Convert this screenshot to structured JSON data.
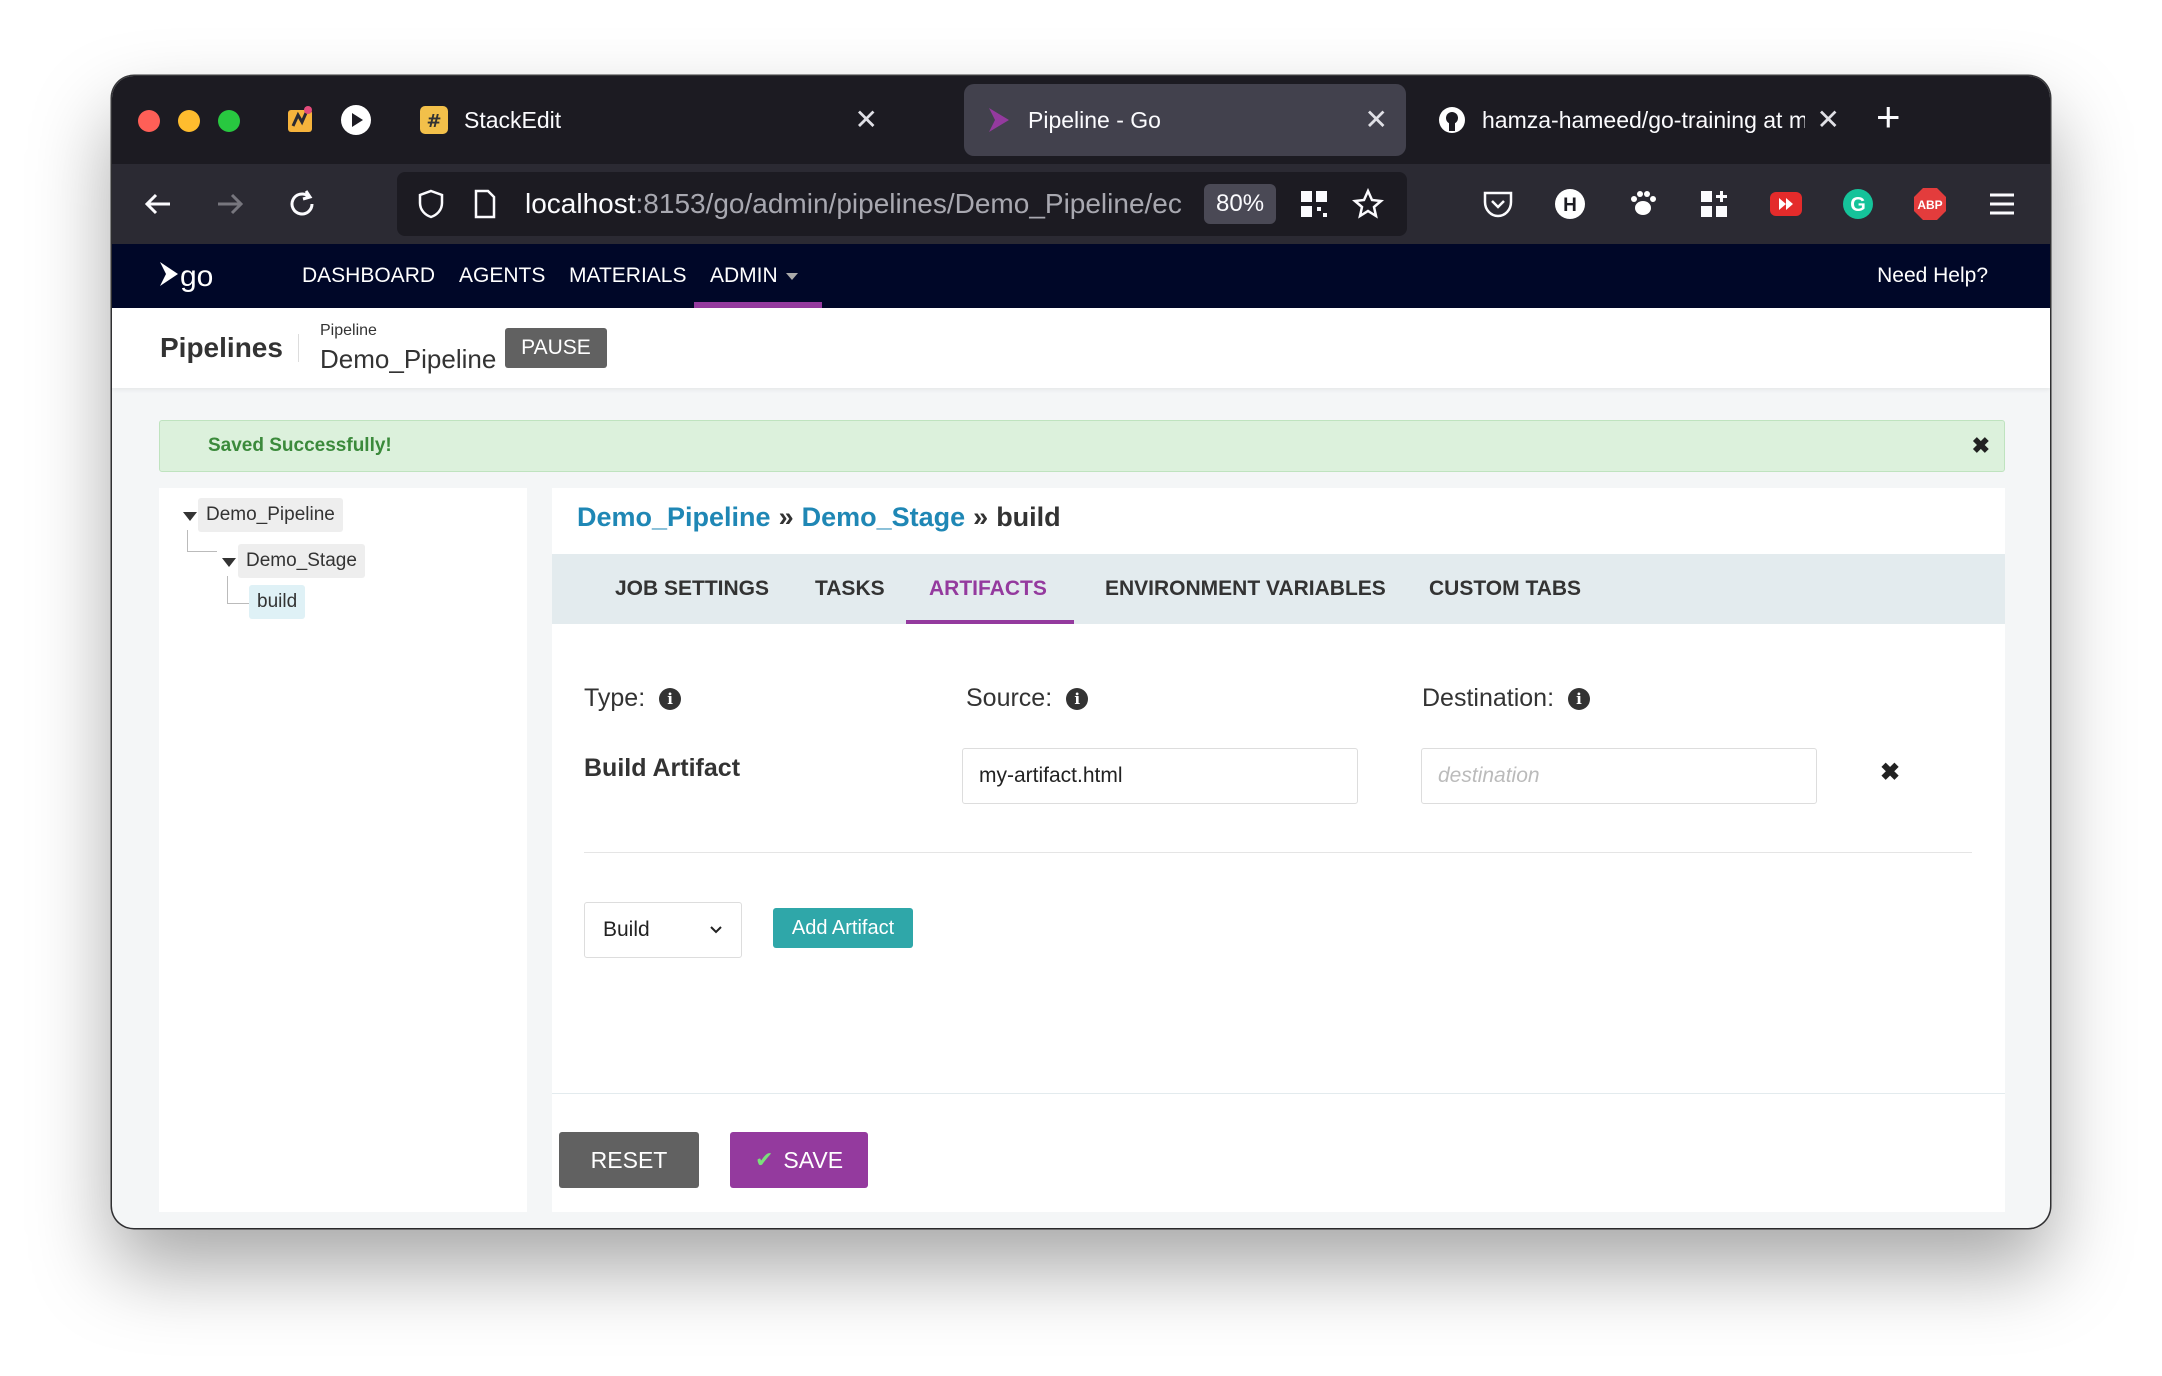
{
  "browser": {
    "tabs": [
      {
        "title": "StackEdit",
        "active": false
      },
      {
        "title": "Pipeline - Go",
        "active": true
      },
      {
        "title": "hamza-hameed/go-training at m",
        "active": false
      }
    ],
    "url_host": "localhost",
    "url_path": ":8153/go/admin/pipelines/Demo_Pipeline/ec",
    "zoom": "80%"
  },
  "gocd_nav": {
    "items": [
      "DASHBOARD",
      "AGENTS",
      "MATERIALS",
      "ADMIN"
    ],
    "help": "Need Help?"
  },
  "page_header": {
    "title": "Pipelines",
    "pipeline_label": "Pipeline",
    "pipeline_name": "Demo_Pipeline",
    "pause": "PAUSE"
  },
  "flash": {
    "message": "Saved Successfully!"
  },
  "tree": {
    "pipeline": "Demo_Pipeline",
    "stage": "Demo_Stage",
    "job": "build"
  },
  "breadcrumb": {
    "pipeline": "Demo_Pipeline",
    "stage": "Demo_Stage",
    "job": "build",
    "sep": "»"
  },
  "job_tabs": [
    "JOB SETTINGS",
    "TASKS",
    "ARTIFACTS",
    "ENVIRONMENT VARIABLES",
    "CUSTOM TABS"
  ],
  "artifacts": {
    "type_label": "Type:",
    "source_label": "Source:",
    "destination_label": "Destination:",
    "row": {
      "type": "Build Artifact",
      "source": "my-artifact.html",
      "destination": "",
      "destination_placeholder": "destination"
    },
    "type_select": "Build",
    "add_button": "Add Artifact"
  },
  "actions": {
    "reset": "RESET",
    "save": "SAVE"
  },
  "colors": {
    "go_header": "#000728",
    "accent_purple": "#943a9e",
    "link_blue": "#1f87b5",
    "teal": "#2fa7a9"
  }
}
